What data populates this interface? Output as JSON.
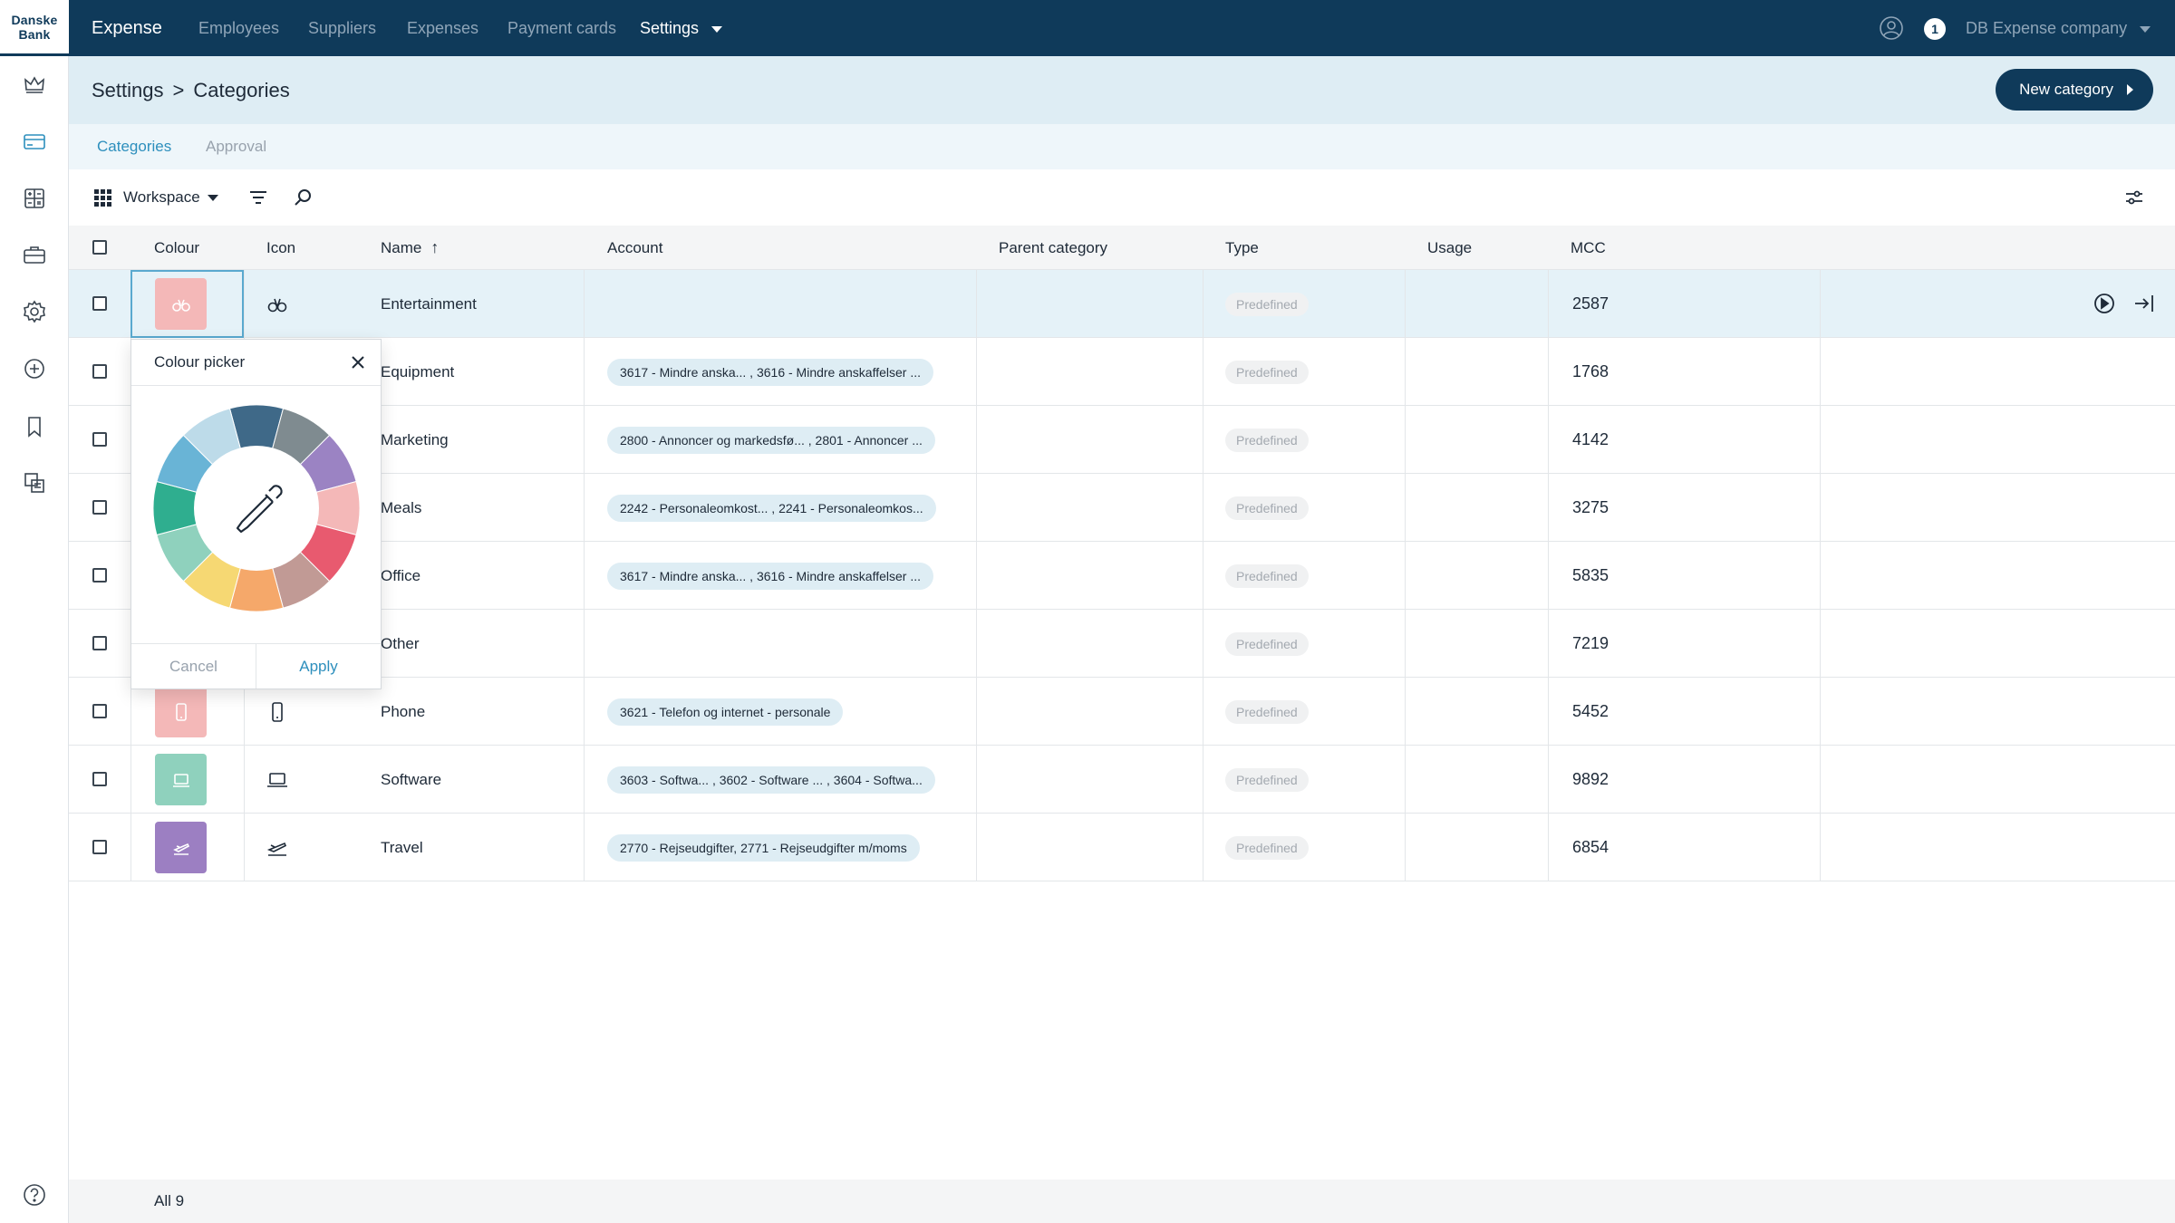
{
  "logo": {
    "line1": "Danske",
    "line2": "Bank"
  },
  "topnav": {
    "brand": "Expense",
    "items": [
      "Employees",
      "Suppliers",
      "Expenses",
      "Payment cards"
    ],
    "active": "Settings",
    "notification_count": "1",
    "company": "DB Expense company"
  },
  "header": {
    "crumb_parent": "Settings",
    "crumb_sep": ">",
    "crumb_current": "Categories",
    "new_button": "New category"
  },
  "tabs": {
    "categories": "Categories",
    "approval": "Approval"
  },
  "toolbar": {
    "workspace": "Workspace"
  },
  "table": {
    "headers": {
      "colour": "Colour",
      "icon": "Icon",
      "name": "Name",
      "account": "Account",
      "parent": "Parent category",
      "type": "Type",
      "usage": "Usage",
      "mcc": "MCC"
    },
    "rows": [
      {
        "name": "Entertainment",
        "account": "",
        "type": "Predefined",
        "mcc": "2587",
        "color": "#f4b8b8",
        "icon": "binoculars-icon"
      },
      {
        "name": "Equipment",
        "account": "3617 - Mindre anska... , 3616 - Mindre anskaffelser ...",
        "type": "Predefined",
        "mcc": "1768",
        "color": "#f4b8b8",
        "icon": "equipment-icon"
      },
      {
        "name": "Marketing",
        "account": "2800 - Annoncer og markedsfø... , 2801 - Annoncer ...",
        "type": "Predefined",
        "mcc": "4142",
        "color": "#f4b8b8",
        "icon": "megaphone-icon"
      },
      {
        "name": "Meals",
        "account": "2242 - Personaleomkost... , 2241 - Personaleomkos...",
        "type": "Predefined",
        "mcc": "3275",
        "color": "#f4b8b8",
        "icon": "cutlery-icon"
      },
      {
        "name": "Office",
        "account": "3617 - Mindre anska... , 3616 - Mindre anskaffelser ...",
        "type": "Predefined",
        "mcc": "5835",
        "color": "#f4b8b8",
        "icon": "office-icon"
      },
      {
        "name": "Other",
        "account": "",
        "type": "Predefined",
        "mcc": "7219",
        "color": "#f4b8b8",
        "icon": "other-icon"
      },
      {
        "name": "Phone",
        "account": "3621 - Telefon og internet - personale",
        "type": "Predefined",
        "mcc": "5452",
        "color": "#f4b8b8",
        "icon": "phone-icon"
      },
      {
        "name": "Software",
        "account": "3603 - Softwa... , 3602 - Software ... , 3604 - Softwa...",
        "type": "Predefined",
        "mcc": "9892",
        "color": "#8fd1bd",
        "icon": "laptop-icon"
      },
      {
        "name": "Travel",
        "account": "2770 - Rejseudgifter, 2771 - Rejseudgifter m/moms",
        "type": "Predefined",
        "mcc": "6854",
        "color": "#9c7fc2",
        "icon": "plane-icon"
      }
    ]
  },
  "picker": {
    "title": "Colour picker",
    "cancel": "Cancel",
    "apply": "Apply",
    "colors": [
      "#3f6988",
      "#7f8b90",
      "#9b83c3",
      "#f4b8b8",
      "#e85a6f",
      "#c19a95",
      "#f5a86a",
      "#f6d873",
      "#8fd1bd",
      "#2fae8f",
      "#69b4d6",
      "#bddbe9"
    ]
  },
  "footer": {
    "count": "All 9"
  }
}
